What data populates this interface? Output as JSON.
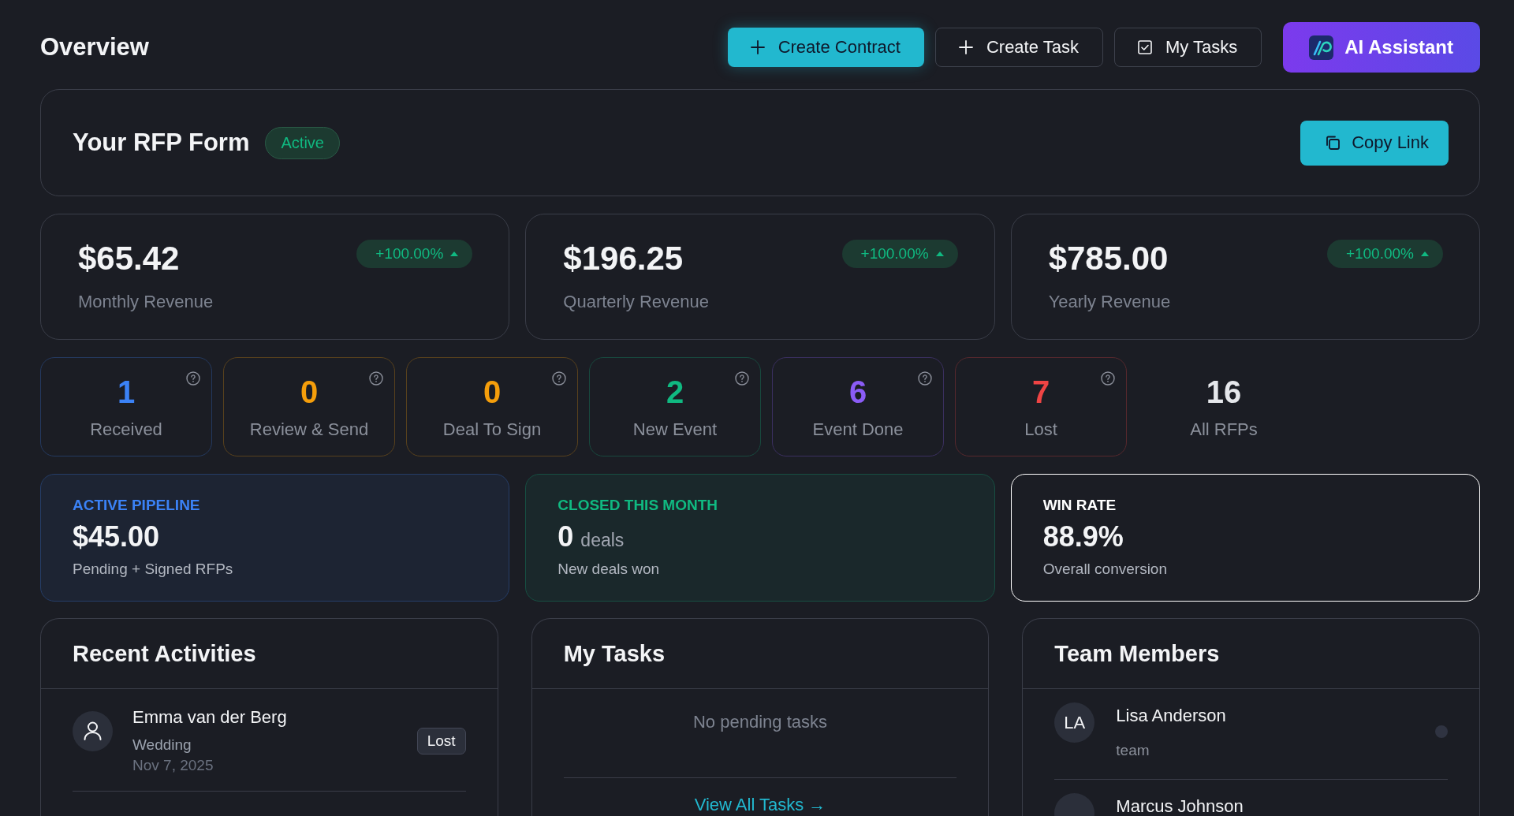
{
  "header": {
    "title": "Overview",
    "buttons": [
      {
        "label": "Create Contract",
        "kind": "primary"
      },
      {
        "label": "Create Task",
        "kind": "secondary"
      },
      {
        "label": "My Tasks",
        "kind": "checklist"
      },
      {
        "label": "AI Assistant",
        "kind": "assistant"
      }
    ]
  },
  "rfp_form": {
    "title": "Your RFP Form",
    "status": "Active",
    "copy_button": "Copy Link"
  },
  "revenue_cards": [
    {
      "value": "$65.42",
      "label": "Monthly Revenue",
      "change": "+100.00%",
      "rising": true
    },
    {
      "value": "$196.25",
      "label": "Quarterly Revenue",
      "change": "+100.00%",
      "rising": true
    },
    {
      "value": "$785.00",
      "label": "Yearly Revenue",
      "change": "+100.00%",
      "rising": true
    }
  ],
  "status_counts": [
    {
      "count": "1",
      "label": "Received",
      "color": "#3b82f6",
      "kind": "status"
    },
    {
      "count": "0",
      "label": "Review & Send",
      "color": "#f59e0b",
      "kind": "status"
    },
    {
      "count": "0",
      "label": "Deal To Sign",
      "color": "#f59e0b",
      "kind": "status"
    },
    {
      "count": "2",
      "label": "New Event",
      "color": "#10b981",
      "kind": "status"
    },
    {
      "count": "6",
      "label": "Event Done",
      "color": "#8b5cf6",
      "kind": "status"
    },
    {
      "count": "7",
      "label": "Lost",
      "color": "#ef4444",
      "kind": "status"
    },
    {
      "count": "16",
      "label": "All RFPs",
      "color": "#e5e7eb",
      "kind": "total"
    }
  ],
  "highlights": [
    {
      "label": "ACTIVE PIPELINE",
      "value": "$45.00",
      "note": "Pending + Signed RFPs",
      "color": "#3b82f6",
      "kind": "tinted"
    },
    {
      "label": "CLOSED THIS MONTH",
      "value": "0",
      "unit": "deals",
      "note": "New deals won",
      "color": "#10b981",
      "kind": "tinted"
    },
    {
      "label": "WIN RATE",
      "value": "88.9%",
      "note": "Overall conversion",
      "color": "#ffffff",
      "kind": "outlined"
    }
  ],
  "recent_activities": {
    "title": "Recent Activities",
    "items": [
      {
        "name": "Emma van der Berg",
        "event": "Wedding",
        "date": "Nov 7, 2025",
        "status": "Lost"
      }
    ]
  },
  "my_tasks": {
    "title": "My Tasks",
    "empty_text": "No pending tasks",
    "link": "View All Tasks →"
  },
  "team_members": {
    "title": "Team Members",
    "members": [
      {
        "initials": "LA",
        "name": "Lisa Anderson",
        "role": "team",
        "online": false
      },
      {
        "name": "Marcus Johnson"
      }
    ]
  }
}
